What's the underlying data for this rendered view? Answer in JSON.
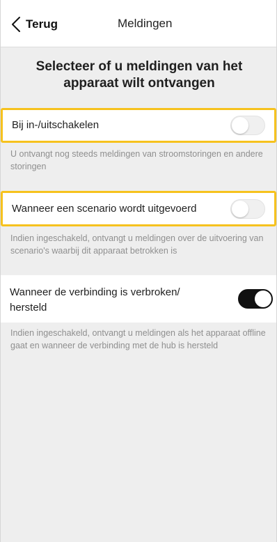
{
  "header": {
    "back_label": "Terug",
    "title": "Meldingen"
  },
  "heading": "Selecteer of u meldingen van het apparaat wilt ontvangen",
  "settings": [
    {
      "label": "Bij in-/uitschakelen",
      "enabled": false,
      "description": "U ontvangt nog steeds meldingen van stroomstoringen en andere storingen"
    },
    {
      "label": "Wanneer een scenario wordt uitgevoerd",
      "enabled": false,
      "description": "Indien ingeschakeld, ontvangt u meldingen over de uitvoering van scenario's waarbij dit apparaat betrokken is"
    },
    {
      "label": "Wanneer de verbinding is verbroken/ hersteld",
      "enabled": true,
      "description": "Indien ingeschakeld, ontvangt u meldingen als het apparaat offline gaat en wanneer de verbinding met de hub is hersteld"
    }
  ],
  "colors": {
    "highlight": "#f6c21e",
    "toggle_on": "#111111",
    "toggle_off": "#f0f0f0",
    "background": "#eeeeee"
  }
}
